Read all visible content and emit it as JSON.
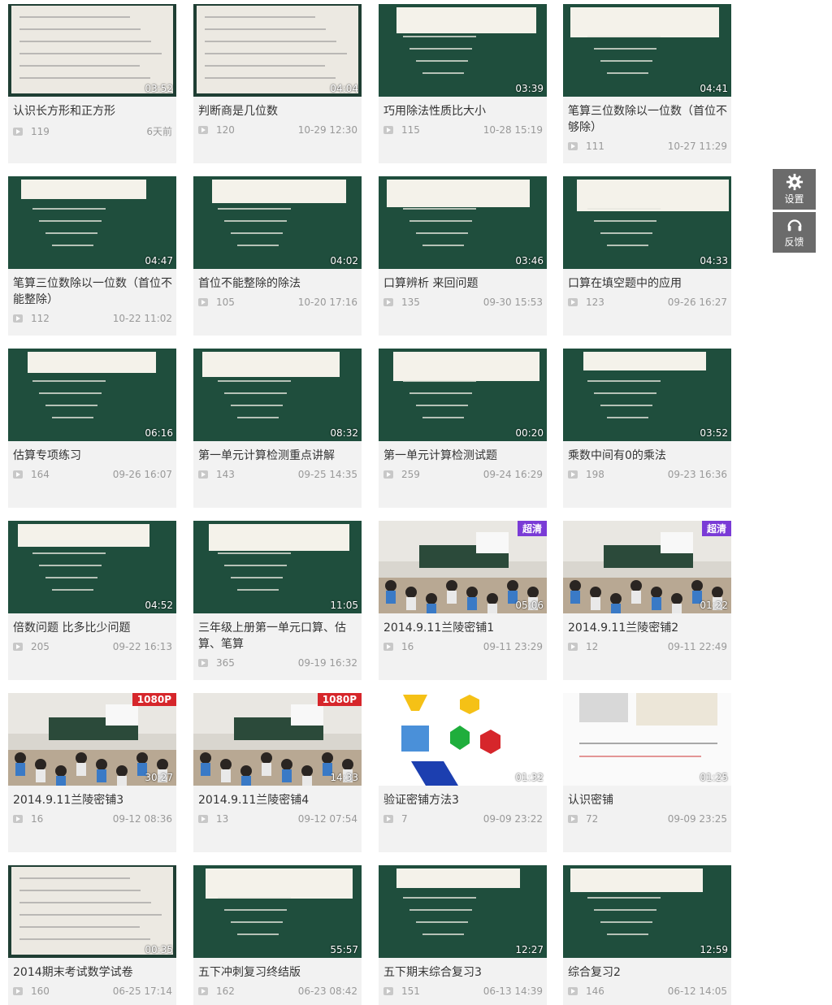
{
  "sidebar": {
    "settings_label": "设置",
    "feedback_label": "反馈"
  },
  "videos": [
    {
      "title": "认识长方形和正方形",
      "views": "119",
      "date": "6天前",
      "duration": "03:52",
      "theme": "paper"
    },
    {
      "title": "判断商是几位数",
      "views": "120",
      "date": "10-29 12:30",
      "duration": "04:04",
      "theme": "paper"
    },
    {
      "title": "巧用除法性质比大小",
      "views": "115",
      "date": "10-28 15:19",
      "duration": "03:39",
      "theme": "board"
    },
    {
      "title": "笔算三位数除以一位数（首位不够除）",
      "views": "111",
      "date": "10-27 11:29",
      "duration": "04:41",
      "theme": "board"
    },
    {
      "title": "笔算三位数除以一位数（首位不能整除）",
      "views": "112",
      "date": "10-22 11:02",
      "duration": "04:47",
      "theme": "board"
    },
    {
      "title": "首位不能整除的除法",
      "views": "105",
      "date": "10-20 17:16",
      "duration": "04:02",
      "theme": "board"
    },
    {
      "title": "口算辨析 来回问题",
      "views": "135",
      "date": "09-30 15:53",
      "duration": "03:46",
      "theme": "board"
    },
    {
      "title": "口算在填空题中的应用",
      "views": "123",
      "date": "09-26 16:27",
      "duration": "04:33",
      "theme": "board"
    },
    {
      "title": "估算专项练习",
      "views": "164",
      "date": "09-26 16:07",
      "duration": "06:16",
      "theme": "board"
    },
    {
      "title": "第一单元计算检测重点讲解",
      "views": "143",
      "date": "09-25 14:35",
      "duration": "08:32",
      "theme": "board"
    },
    {
      "title": "第一单元计算检测试题",
      "views": "259",
      "date": "09-24 16:29",
      "duration": "00:20",
      "theme": "board"
    },
    {
      "title": "乘数中间有0的乘法",
      "views": "198",
      "date": "09-23 16:36",
      "duration": "03:52",
      "theme": "board"
    },
    {
      "title": "倍数问题 比多比少问题",
      "views": "205",
      "date": "09-22 16:13",
      "duration": "04:52",
      "theme": "board"
    },
    {
      "title": "三年级上册第一单元口算、估算、笔算",
      "views": "365",
      "date": "09-19 16:32",
      "duration": "11:05",
      "theme": "board"
    },
    {
      "title": "2014.9.11兰陵密铺1",
      "views": "16",
      "date": "09-11 23:29",
      "duration": "05:06",
      "theme": "classroom",
      "badge": "超清"
    },
    {
      "title": "2014.9.11兰陵密铺2",
      "views": "12",
      "date": "09-11 22:49",
      "duration": "01:22",
      "theme": "classroom",
      "badge": "超清"
    },
    {
      "title": "2014.9.11兰陵密铺3",
      "views": "16",
      "date": "09-12 08:36",
      "duration": "30:27",
      "theme": "classroom",
      "badge": "1080P"
    },
    {
      "title": "2014.9.11兰陵密铺4",
      "views": "13",
      "date": "09-12 07:54",
      "duration": "14:33",
      "theme": "classroom",
      "badge": "1080P"
    },
    {
      "title": "验证密铺方法3",
      "views": "7",
      "date": "09-09 23:22",
      "duration": "01:32",
      "theme": "shapes"
    },
    {
      "title": "认识密铺",
      "views": "72",
      "date": "09-09 23:25",
      "duration": "01:25",
      "theme": "white"
    },
    {
      "title": "2014期末考试数学试卷",
      "views": "160",
      "date": "06-25 17:14",
      "duration": "00:35",
      "theme": "paper"
    },
    {
      "title": "五下冲刺复习终结版",
      "views": "162",
      "date": "06-23 08:42",
      "duration": "55:57",
      "theme": "board"
    },
    {
      "title": "五下期末综合复习3",
      "views": "151",
      "date": "06-13 14:39",
      "duration": "12:27",
      "theme": "board"
    },
    {
      "title": "综合复习2",
      "views": "146",
      "date": "06-12 14:05",
      "duration": "12:59",
      "theme": "board"
    }
  ],
  "colors": {
    "board": "#1f4e3d",
    "paper": "#e8e6df",
    "card_bg": "#f2f2f2",
    "badge_hd": "#7a3bd6",
    "badge_1080": "#d6262b"
  }
}
